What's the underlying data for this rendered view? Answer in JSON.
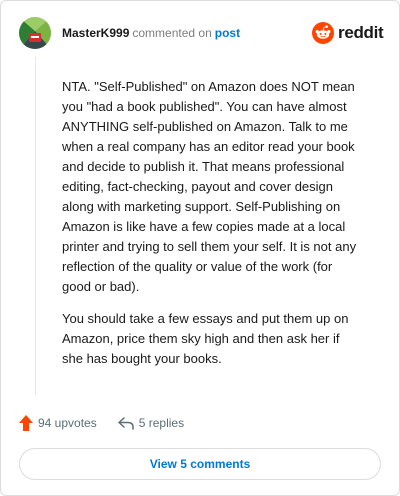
{
  "comment": {
    "author": "MasterK999",
    "action_text": "commented on",
    "post_link": "post",
    "paragraphs": [
      "NTA. \"Self-Published\" on Amazon does NOT mean you \"had a book published\". You can have almost ANYTHING self-published on Amazon. Talk to me when a real company has an editor read your book and decide to publish it. That means professional editing, fact-checking, payout and cover design along with marketing support. Self-Publishing on Amazon is like have a few copies made at a local printer and trying to sell them your self. It is not any reflection of the quality or value of the work (for good or bad).",
      "You should take a few essays and put them up on Amazon, price them sky high and then ask her if she has bought your books."
    ]
  },
  "brand": {
    "name": "reddit",
    "icon": "reddit-logo-icon",
    "color": "#ff4500"
  },
  "footer": {
    "upvotes_label": "94 upvotes",
    "replies_label": "5 replies",
    "view_comments_label": "View 5 comments"
  },
  "colors": {
    "accent": "#0079d3",
    "upvote": "#ff4500",
    "muted": "#7c7c7c"
  }
}
